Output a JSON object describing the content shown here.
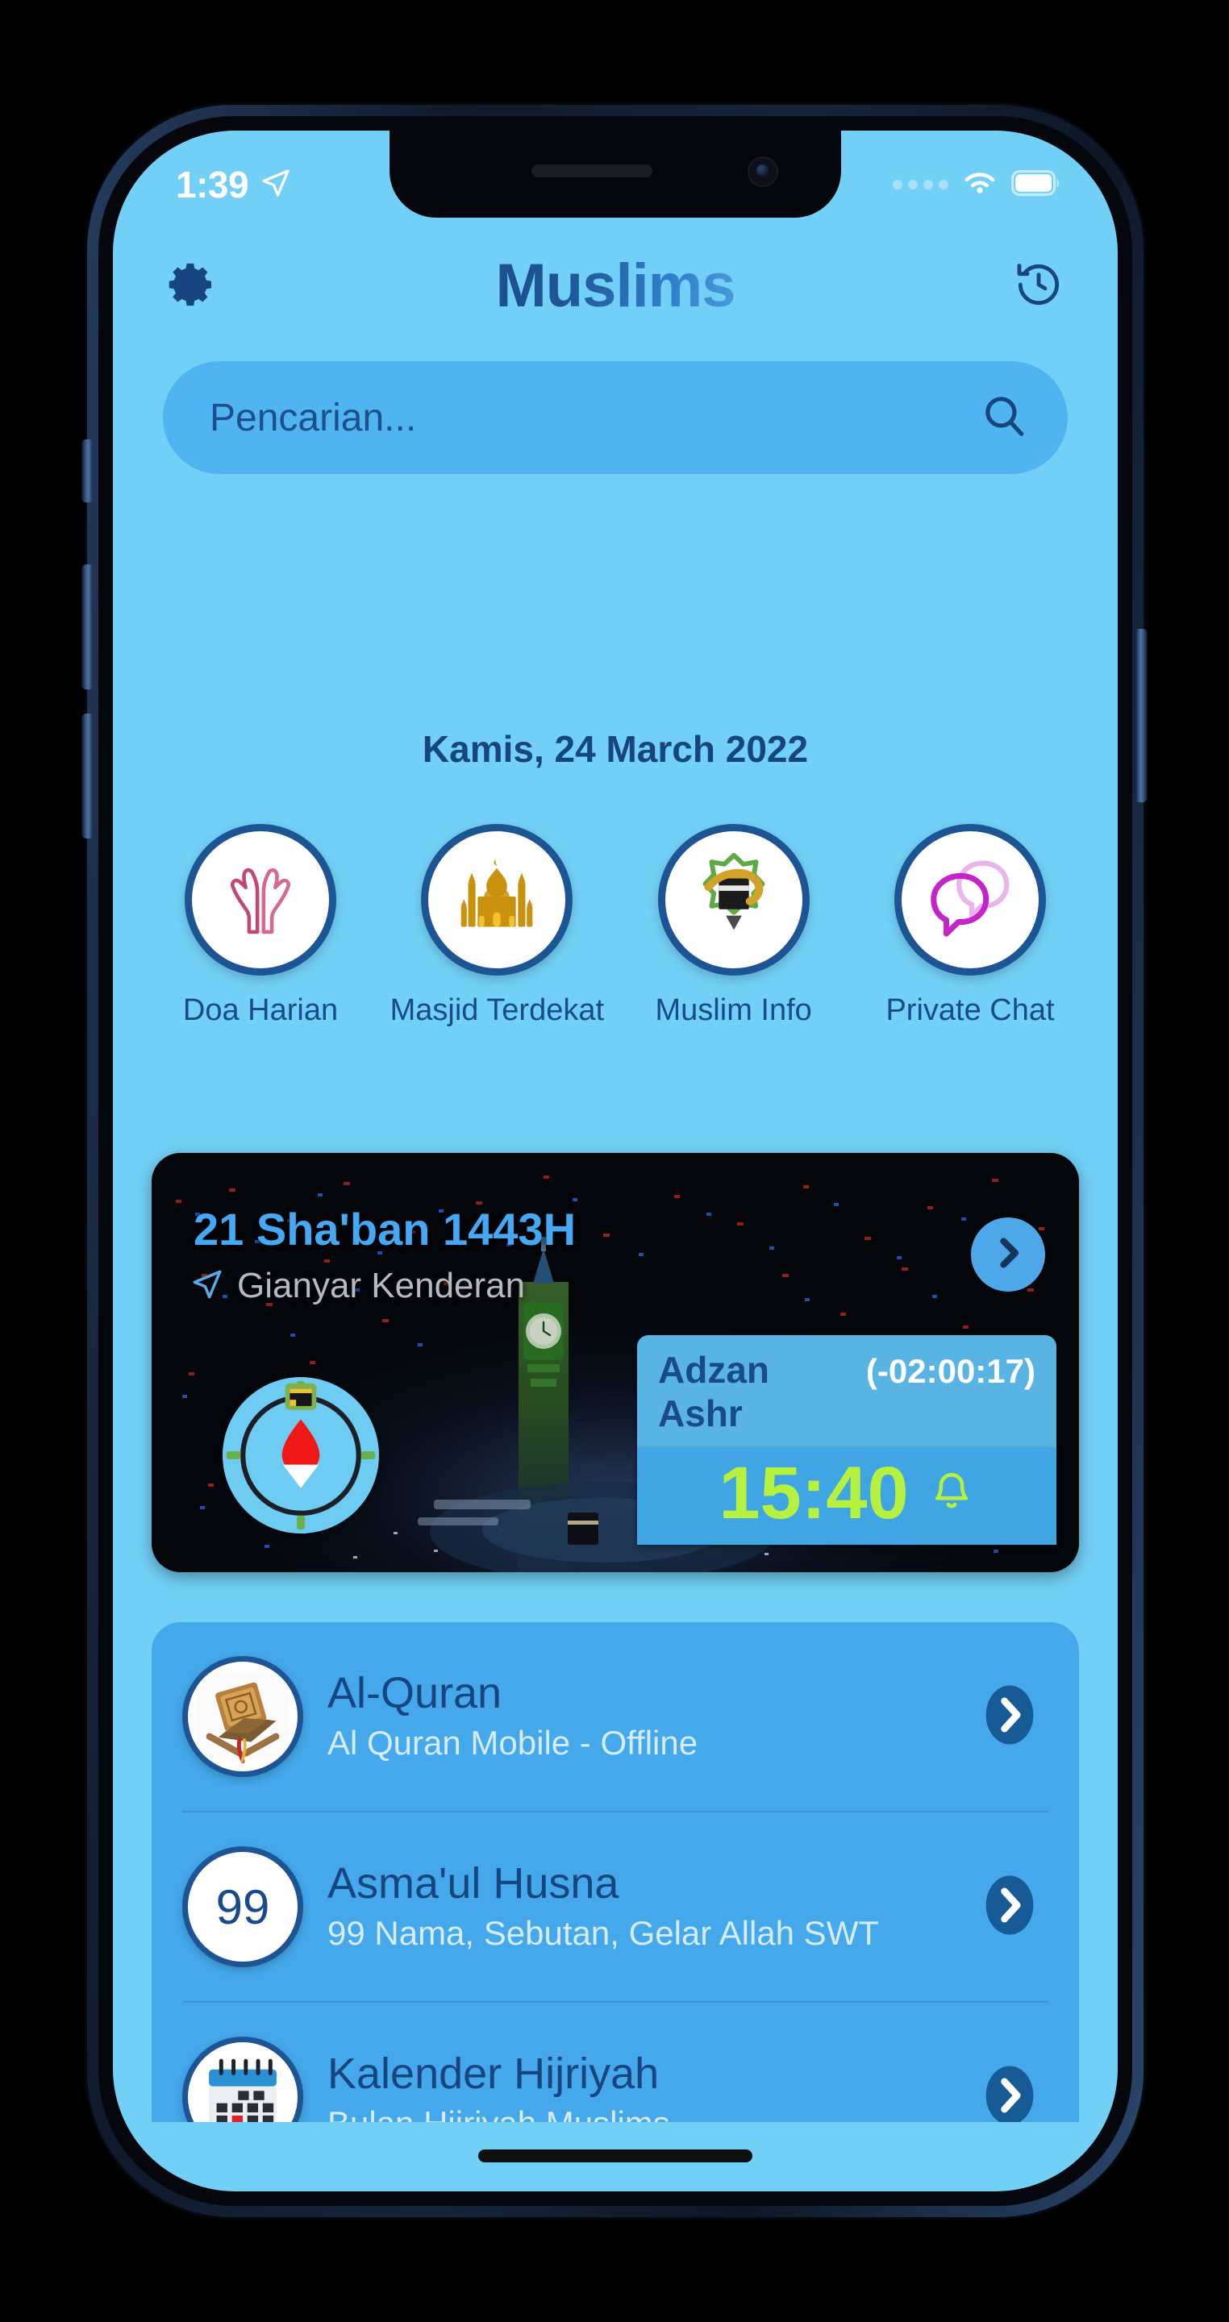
{
  "status_bar": {
    "time": "1:39",
    "location_icon": "location-arrow-icon",
    "signal_icon": "signal-dots-icon",
    "wifi_icon": "wifi-icon",
    "battery_icon": "battery-full-icon"
  },
  "header": {
    "title": "Muslims",
    "settings_icon": "gear-icon",
    "history_icon": "history-clock-icon"
  },
  "search": {
    "placeholder": "Pencarian...",
    "value": "",
    "icon": "search-icon"
  },
  "date_line": "Kamis, 24 March 2022",
  "quick_actions": [
    {
      "label": "Doa Harian",
      "icon": "praying-hands-icon"
    },
    {
      "label": "Masjid Terdekat",
      "icon": "mosque-icon"
    },
    {
      "label": "Muslim Info",
      "icon": "kaaba-star-icon"
    },
    {
      "label": "Private Chat",
      "icon": "chat-bubbles-icon"
    }
  ],
  "banner": {
    "hijri_date": "21 Sha'ban 1443H",
    "location": "Gianyar Kenderan",
    "location_icon": "location-arrow-icon",
    "next_icon": "chevron-right-icon",
    "compass_icon": "qibla-compass-icon",
    "prayer": {
      "name": "Adzan Ashr",
      "countdown": "(-02:00:17)",
      "time": "15:40",
      "alarm_icon": "bell-icon"
    }
  },
  "menu": [
    {
      "title": "Al-Quran",
      "subtitle": "Al Quran Mobile - Offline",
      "icon": "quran-book-icon",
      "arrow_icon": "chevron-right-icon"
    },
    {
      "title": "Asma'ul Husna",
      "subtitle": "99 Nama, Sebutan, Gelar Allah SWT",
      "icon": "99-badge-icon",
      "badge_text": "99",
      "arrow_icon": "chevron-right-icon"
    },
    {
      "title": "Kalender Hijriyah",
      "subtitle": "Bulan Hijriyah Muslims",
      "icon": "calendar-icon",
      "arrow_icon": "chevron-right-icon"
    }
  ],
  "colors": {
    "page_background": "#72cff5",
    "card_background": "#44a8ea",
    "search_background": "#4fb4ef",
    "accent_dark_blue": "#17457f",
    "title_gradient_start": "#1b4f8f",
    "title_gradient_end": "#4b9ada",
    "prayer_time_green": "#b6f13f",
    "hijri_blue": "#45a8f5",
    "subtitle_light": "#d4ecfb"
  }
}
